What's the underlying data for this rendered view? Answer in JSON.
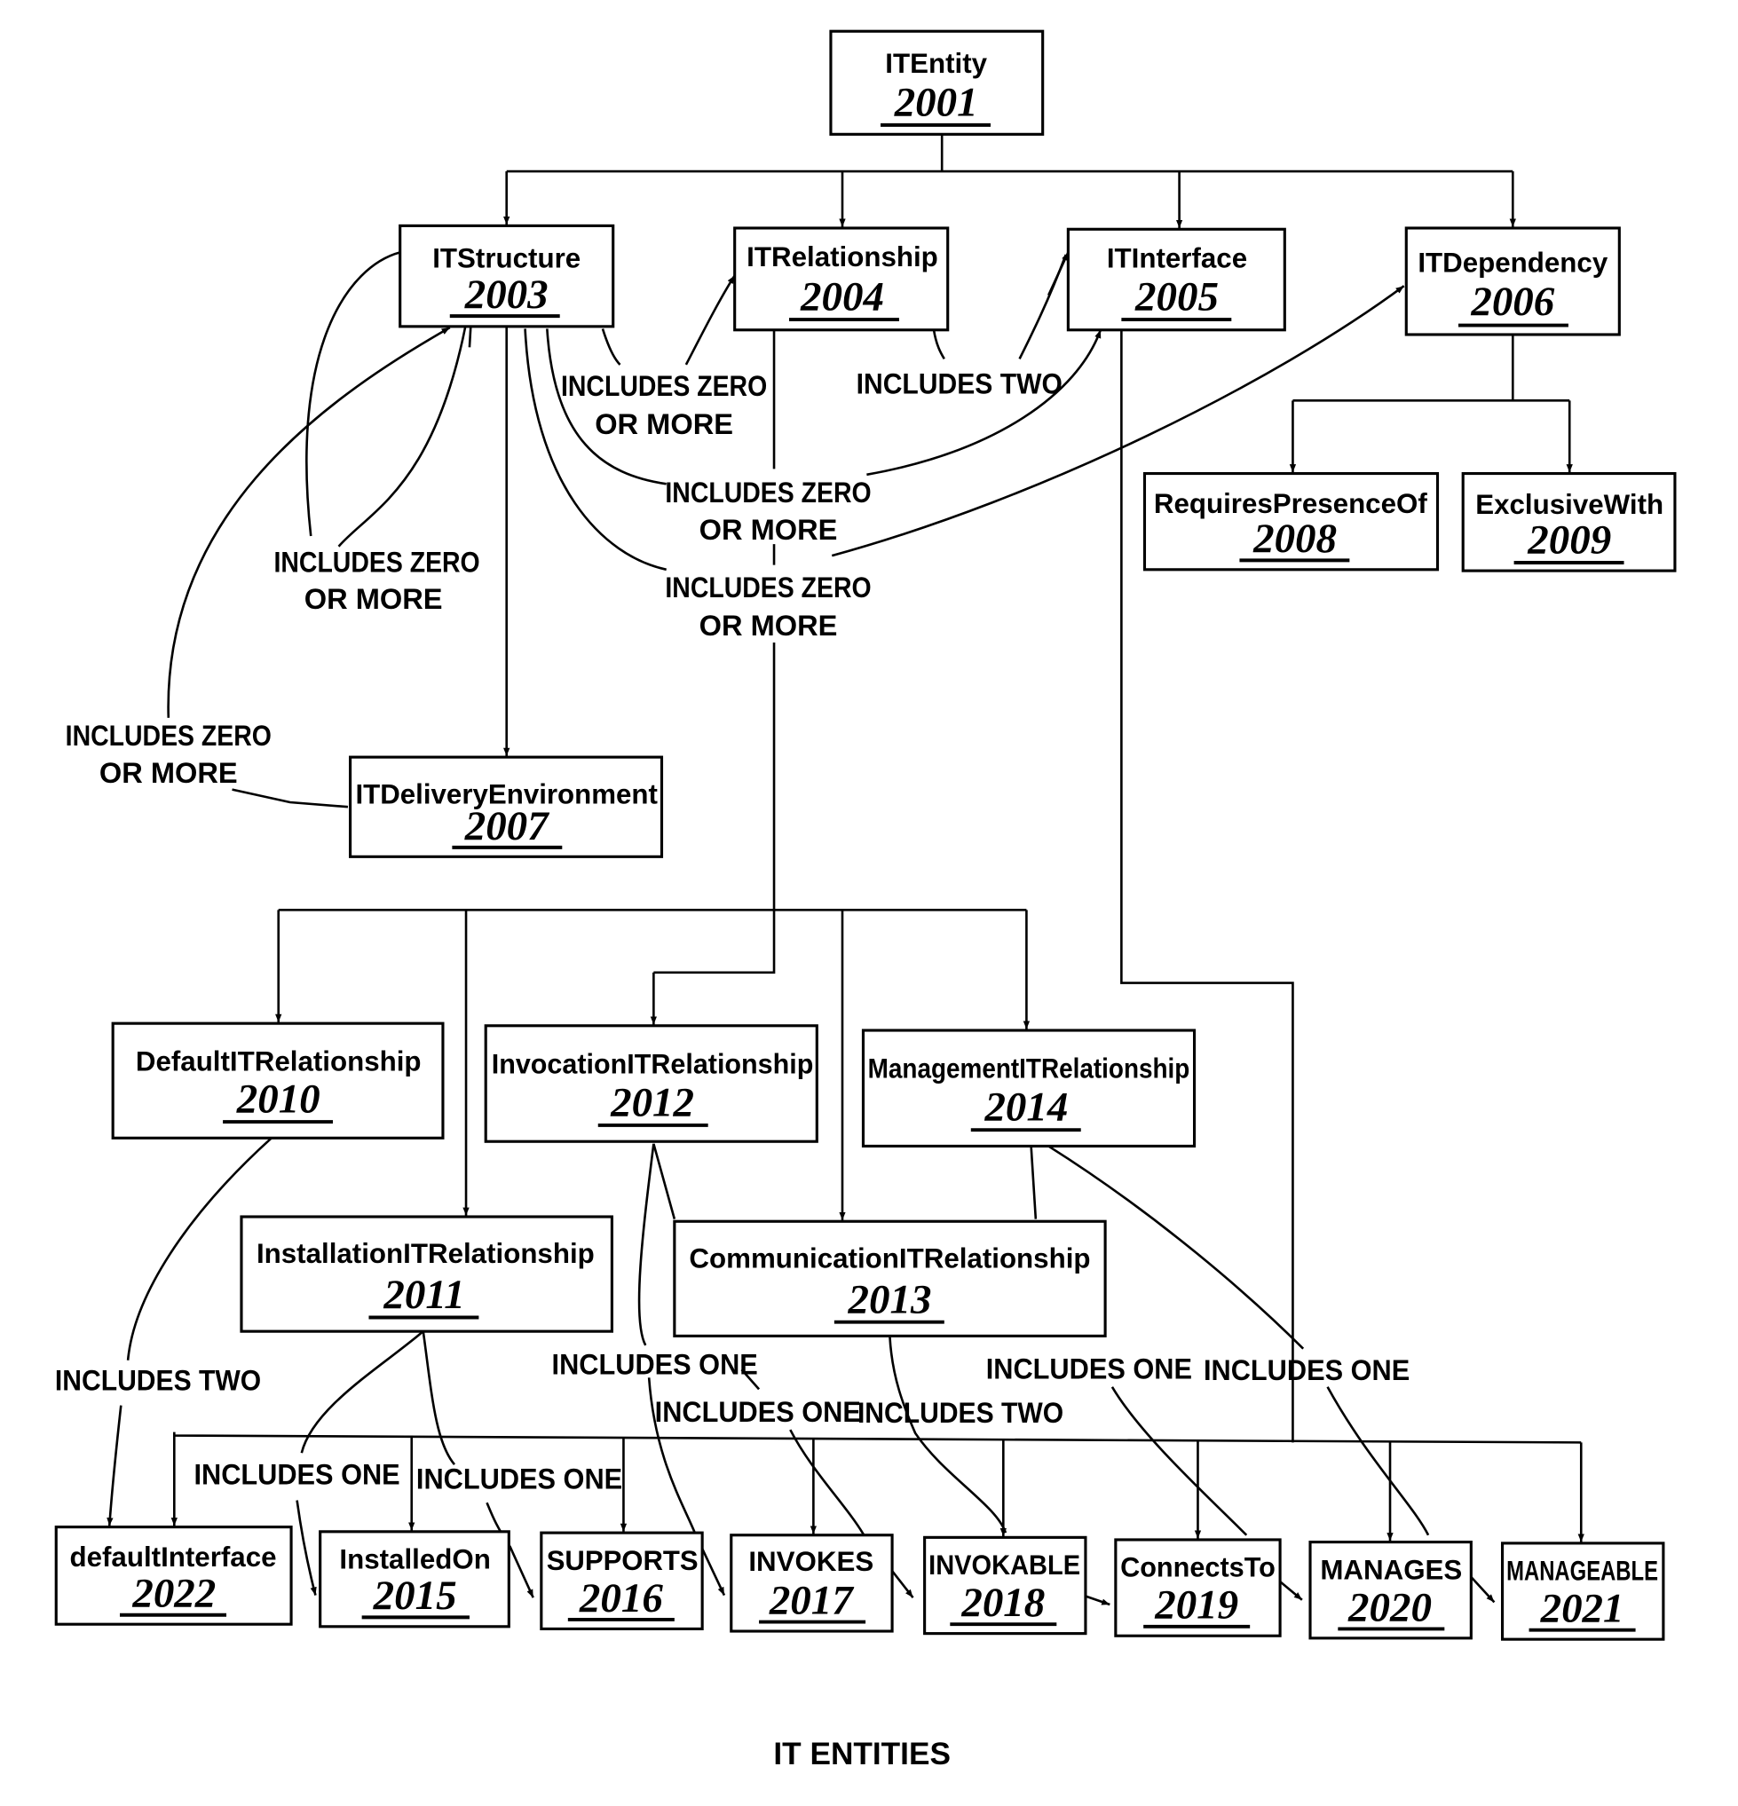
{
  "caption": "IT ENTITIES",
  "nodes": {
    "n2001": {
      "name": "ITEntity",
      "id": "2001"
    },
    "n2003": {
      "name": "ITStructure",
      "id": "2003"
    },
    "n2004": {
      "name": "ITRelationship",
      "id": "2004"
    },
    "n2005": {
      "name": "ITInterface",
      "id": "2005"
    },
    "n2006": {
      "name": "ITDependency",
      "id": "2006"
    },
    "n2007": {
      "name": "ITDeliveryEnvironment",
      "id": "2007"
    },
    "n2008": {
      "name": "RequiresPresenceOf",
      "id": "2008"
    },
    "n2009": {
      "name": "ExclusiveWith",
      "id": "2009"
    },
    "n2010": {
      "name": "DefaultITRelationship",
      "id": "2010"
    },
    "n2011": {
      "name": "InstallationITRelationship",
      "id": "2011"
    },
    "n2012": {
      "name": "InvocationITRelationship",
      "id": "2012"
    },
    "n2013": {
      "name": "CommunicationITRelationship",
      "id": "2013"
    },
    "n2014": {
      "name": "ManagementITRelationship",
      "id": "2014"
    },
    "n2015": {
      "name": "InstalledOn",
      "id": "2015"
    },
    "n2016": {
      "name": "SUPPORTS",
      "id": "2016"
    },
    "n2017": {
      "name": "INVOKES",
      "id": "2017"
    },
    "n2018": {
      "name": "INVOKABLE",
      "id": "2018"
    },
    "n2019": {
      "name": "ConnectsTo",
      "id": "2019"
    },
    "n2020": {
      "name": "MANAGES",
      "id": "2020"
    },
    "n2021": {
      "name": "MANAGEABLE",
      "id": "2021"
    },
    "n2022": {
      "name": "defaultInterface",
      "id": "2022"
    }
  },
  "labels": {
    "zero_or_more_l1": "INCLUDES ZERO",
    "zero_or_more_l2": "OR MORE",
    "includes_two": "INCLUDES TWO",
    "includes_one": "INCLUDES ONE"
  }
}
